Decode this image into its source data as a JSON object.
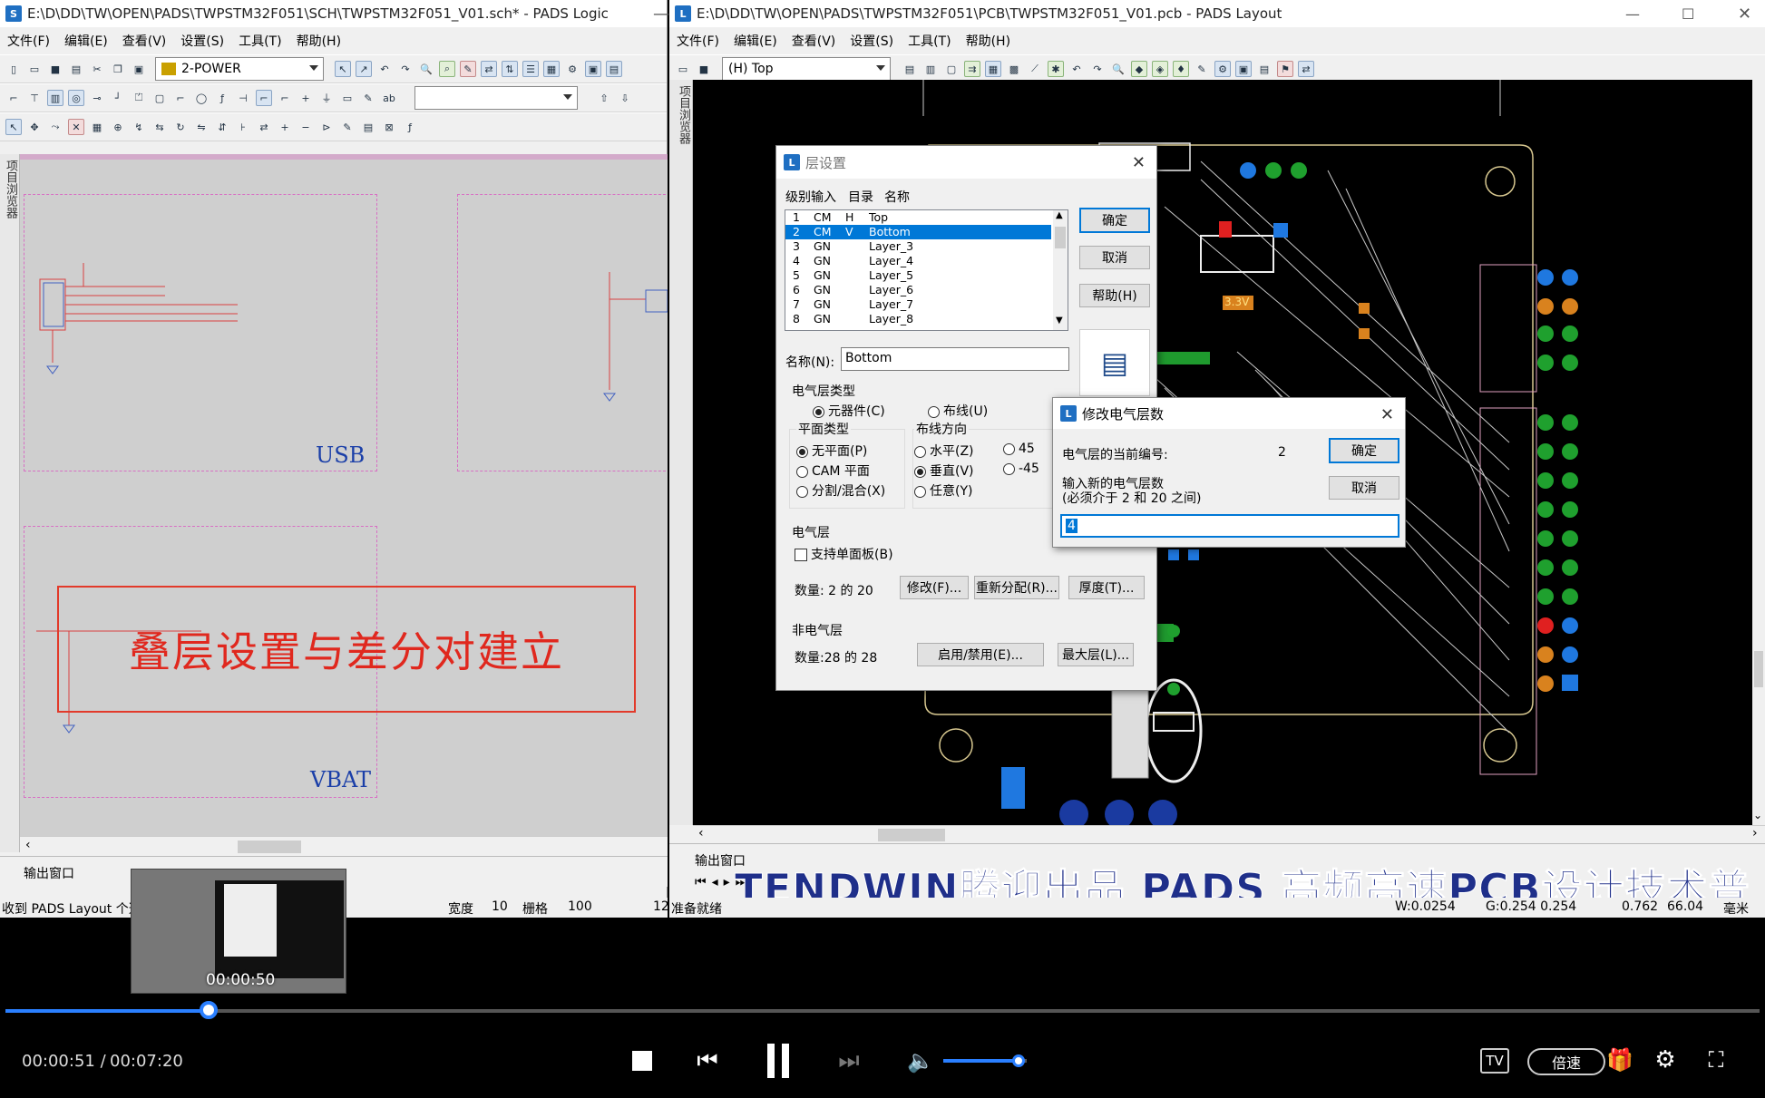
{
  "logic_window": {
    "title": "E:\\D\\DD\\TW\\OPEN\\PADS\\TWPSTM32F051\\SCH\\TWPSTM32F051_V01.sch* - PADS Logic",
    "menu": [
      "文件(F)",
      "编辑(E)",
      "查看(V)",
      "设置(S)",
      "工具(T)",
      "帮助(H)"
    ],
    "sheet_combo": "2-POWER",
    "sidebar_label": "项目浏览器",
    "sheet_labels": [
      "USB",
      "VBAT"
    ],
    "caption": "叠层设置与差分对建立",
    "output_window": "输出窗口",
    "status": {
      "message": "收到 PADS Layout 个选",
      "width_label": "宽度",
      "width_value": "10",
      "grid_label": "栅格",
      "grid_value": "100",
      "extra": "12"
    }
  },
  "layout_window": {
    "title": "E:\\D\\DD\\TW\\OPEN\\PADS\\TWPSTM32F051\\PCB\\TWPSTM32F051_V01.pcb - PADS Layout",
    "menu": [
      "文件(F)",
      "编辑(E)",
      "查看(V)",
      "设置(S)",
      "工具(T)",
      "帮助(H)"
    ],
    "layer_combo": "(H) Top",
    "sidebar_label": "项目浏览器",
    "output_window": "输出窗口",
    "status": {
      "ready": "准备就绪",
      "w": "W:0.0254",
      "g": "G:0.254 0.254",
      "x": "0.762",
      "y": "66.04",
      "unit": "毫米"
    },
    "board_label": "3.3V"
  },
  "layer_dialog": {
    "title": "层设置",
    "list_headers": [
      "级别输入",
      "目录",
      "名称"
    ],
    "layers": [
      {
        "num": "1",
        "type": "CM",
        "dir": "H",
        "name": "Top"
      },
      {
        "num": "2",
        "type": "CM",
        "dir": "V",
        "name": "Bottom"
      },
      {
        "num": "3",
        "type": "GN",
        "dir": "",
        "name": "Layer_3"
      },
      {
        "num": "4",
        "type": "GN",
        "dir": "",
        "name": "Layer_4"
      },
      {
        "num": "5",
        "type": "GN",
        "dir": "",
        "name": "Layer_5"
      },
      {
        "num": "6",
        "type": "GN",
        "dir": "",
        "name": "Layer_6"
      },
      {
        "num": "7",
        "type": "GN",
        "dir": "",
        "name": "Layer_7"
      },
      {
        "num": "8",
        "type": "GN",
        "dir": "",
        "name": "Layer_8"
      }
    ],
    "selected_index": 1,
    "ok": "确定",
    "cancel": "取消",
    "help": "帮助(H)",
    "name_label": "名称(N):",
    "name_value": "Bottom",
    "elec_type_label": "电气层类型",
    "elec_component": "元器件(C)",
    "elec_routing": "布线(U)",
    "plane_type_label": "平面类型",
    "plane_none": "无平面(P)",
    "plane_cam": "CAM 平面",
    "plane_split": "分割/混合(X)",
    "route_dir_label": "布线方向",
    "dir_h": "水平(Z)",
    "dir_v": "垂直(V)",
    "dir_any": "任意(Y)",
    "dir_45": "45",
    "dir_m45": "-45",
    "elec_layer_label": "电气层",
    "single_side": "支持单面板(B)",
    "count_label": "数量: 2 的 20",
    "modify": "修改(F)...",
    "reassign": "重新分配(R)...",
    "thickness": "厚度(T)...",
    "nonelec_label": "非电气层",
    "nonelec_count": "数量:28 的 28",
    "enable": "启用/禁用(E)...",
    "max_layer": "最大层(L)..."
  },
  "modify_dialog": {
    "title": "修改电气层数",
    "current_label": "电气层的当前编号:",
    "current_value": "2",
    "new_label": "输入新的电气层数",
    "range_label": "(必须介于 2 和 20 之间)",
    "input_value": "4",
    "ok": "确定",
    "cancel": "取消"
  },
  "banner": "TENDWIN腾迎出品  PADS 高频高速PCB设计技术普",
  "player": {
    "current_time": "00:00:51 /",
    "total_time": "00:07:20",
    "thumb_time": "00:00:50",
    "speed": "倍速",
    "progress": 0.116,
    "volume": 0.9
  }
}
